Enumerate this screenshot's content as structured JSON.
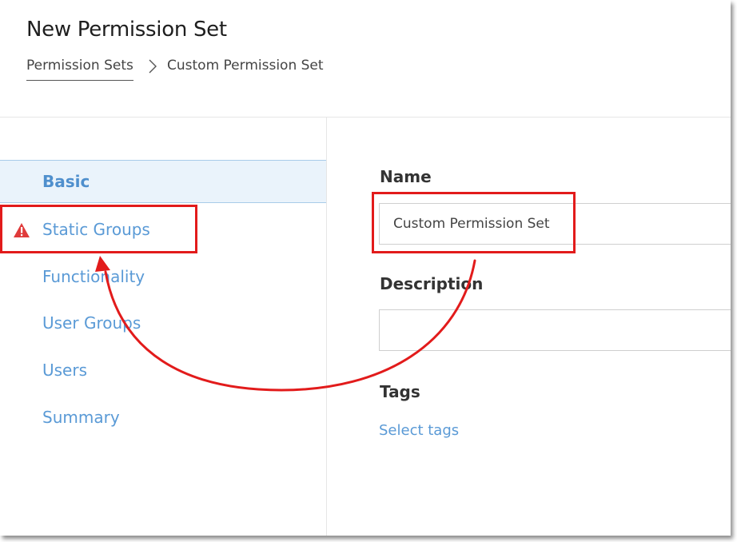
{
  "header": {
    "title": "New Permission Set",
    "breadcrumb": {
      "parent": "Permission Sets",
      "current": "Custom Permission Set",
      "separator_icon": "chevron-right-icon"
    }
  },
  "sidebar": {
    "items": [
      {
        "label": "Basic",
        "state": "active"
      },
      {
        "label": "Static Groups",
        "state": "error",
        "icon": "warning-icon"
      },
      {
        "label": "Functionality"
      },
      {
        "label": "User Groups"
      },
      {
        "label": "Users"
      },
      {
        "label": "Summary"
      }
    ]
  },
  "form": {
    "name": {
      "label": "Name",
      "value": "Custom Permission Set"
    },
    "description": {
      "label": "Description",
      "value": ""
    },
    "tags": {
      "label": "Tags",
      "link": "Select tags"
    }
  },
  "annotations": {
    "highlight_color": "#e21b1b",
    "arrow": "from name field to static-groups tab"
  },
  "colors": {
    "link_blue": "#5a9ad6",
    "active_bg": "#eaf3fb",
    "warning_red": "#e03b3b"
  }
}
